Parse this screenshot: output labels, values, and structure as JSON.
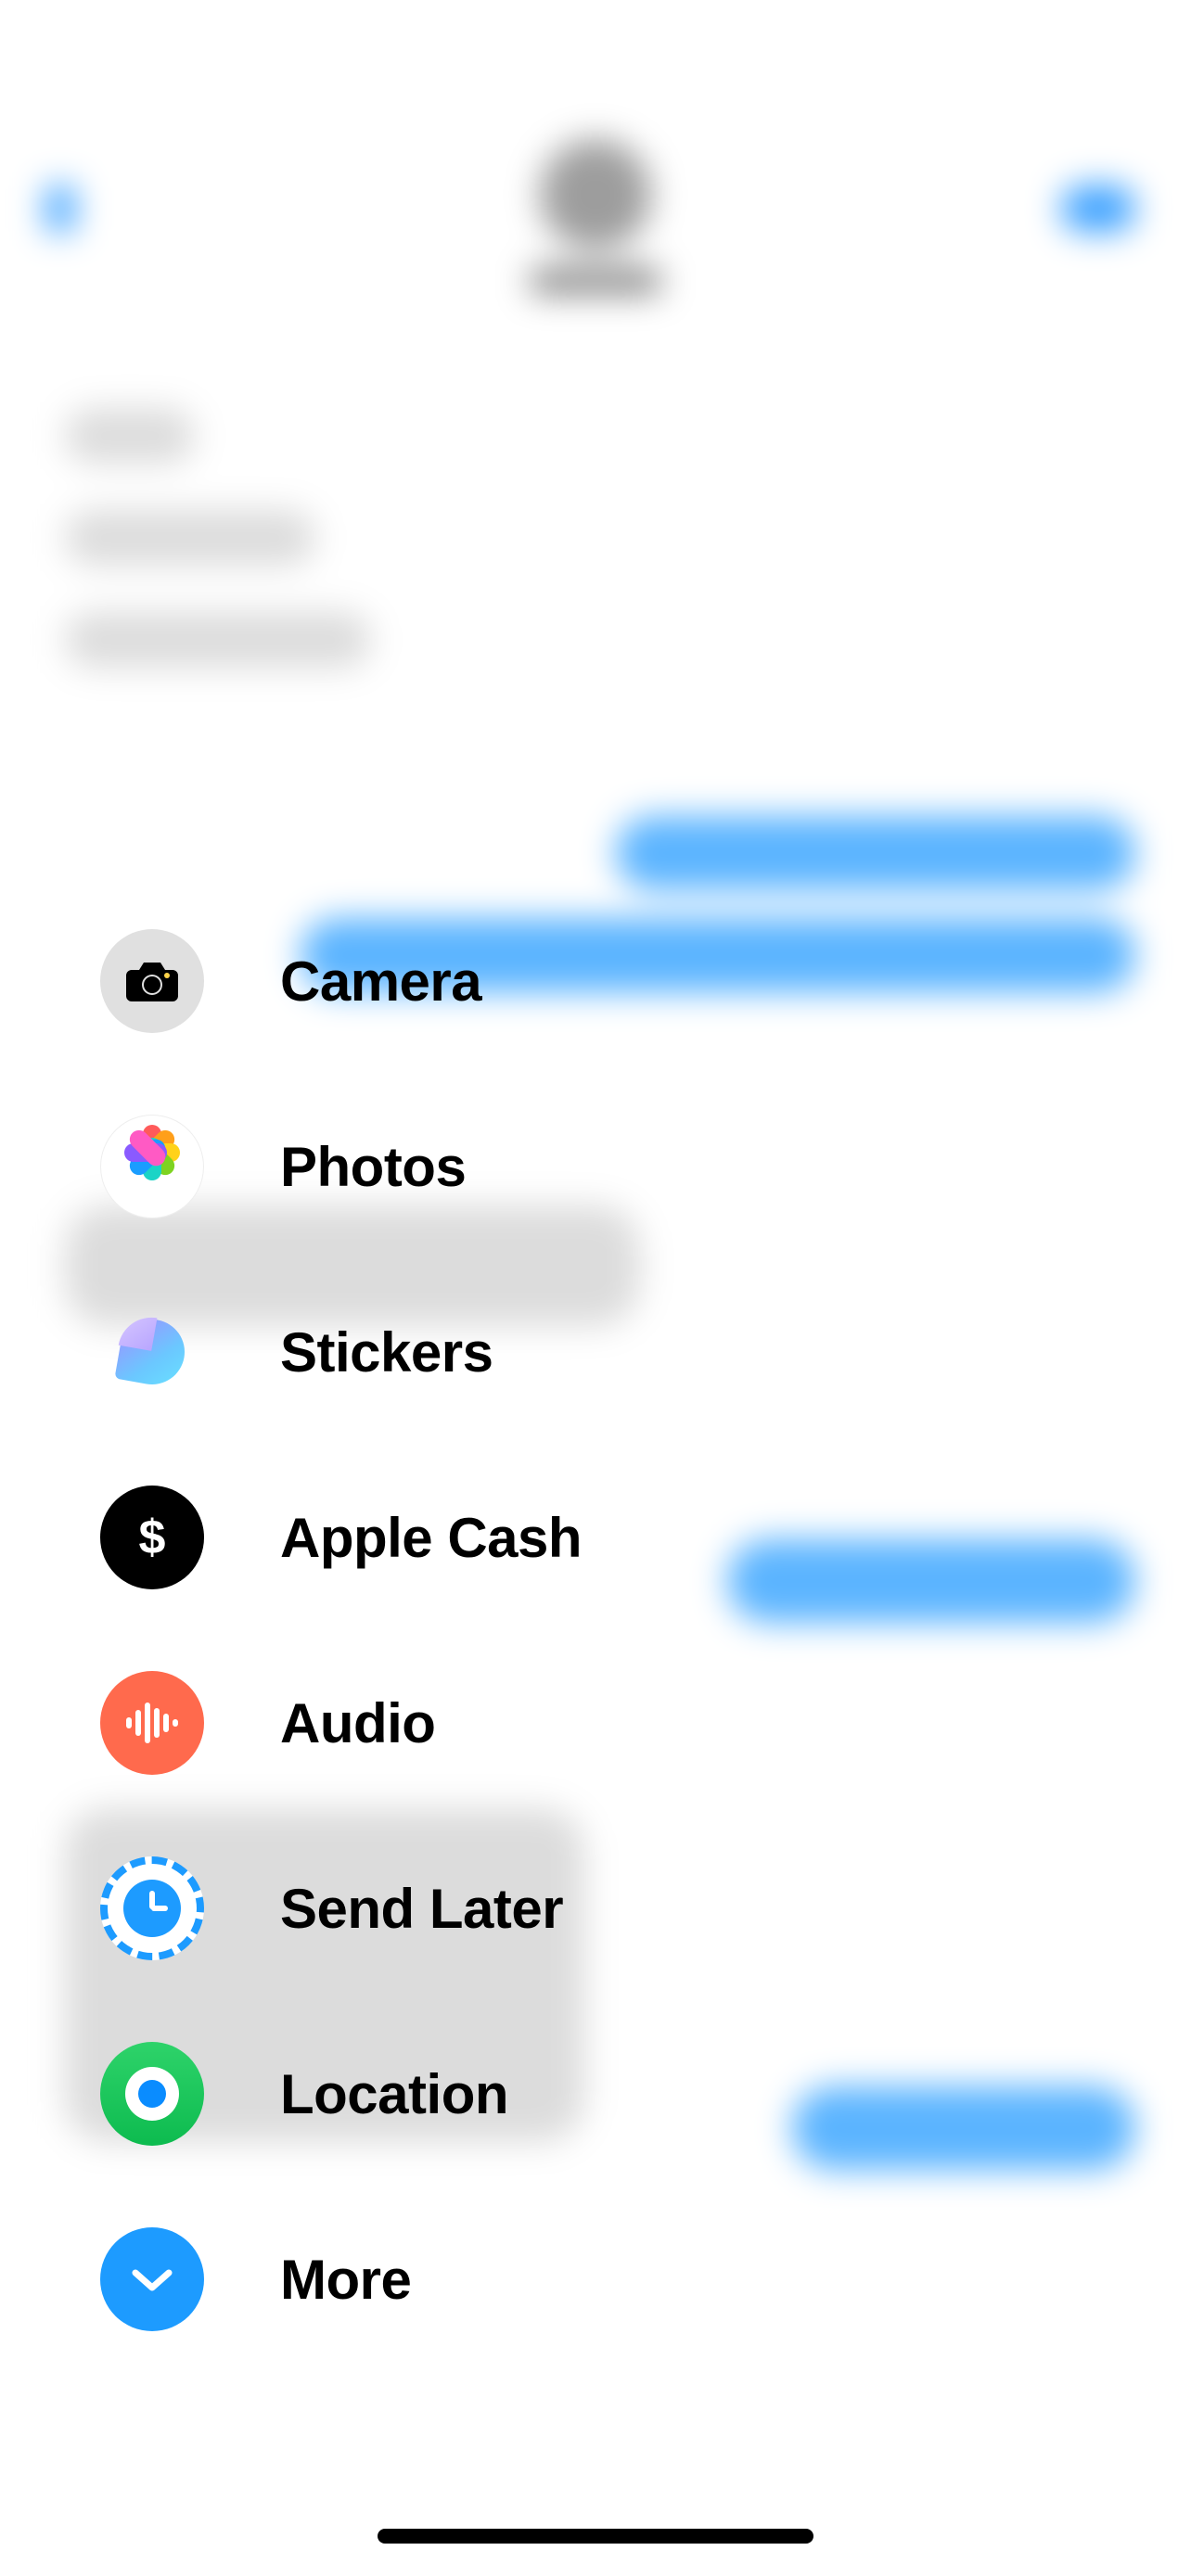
{
  "menu": {
    "camera": {
      "label": "Camera"
    },
    "photos": {
      "label": "Photos"
    },
    "stickers": {
      "label": "Stickers"
    },
    "apple_cash": {
      "label": "Apple Cash"
    },
    "audio": {
      "label": "Audio"
    },
    "send_later": {
      "label": "Send Later"
    },
    "location": {
      "label": "Location"
    },
    "more": {
      "label": "More"
    }
  },
  "colors": {
    "camera_bg": "#e0e0e0",
    "cash_bg": "#000000",
    "audio_bg": "#ff6a4d",
    "more_bg": "#1d9bff"
  }
}
